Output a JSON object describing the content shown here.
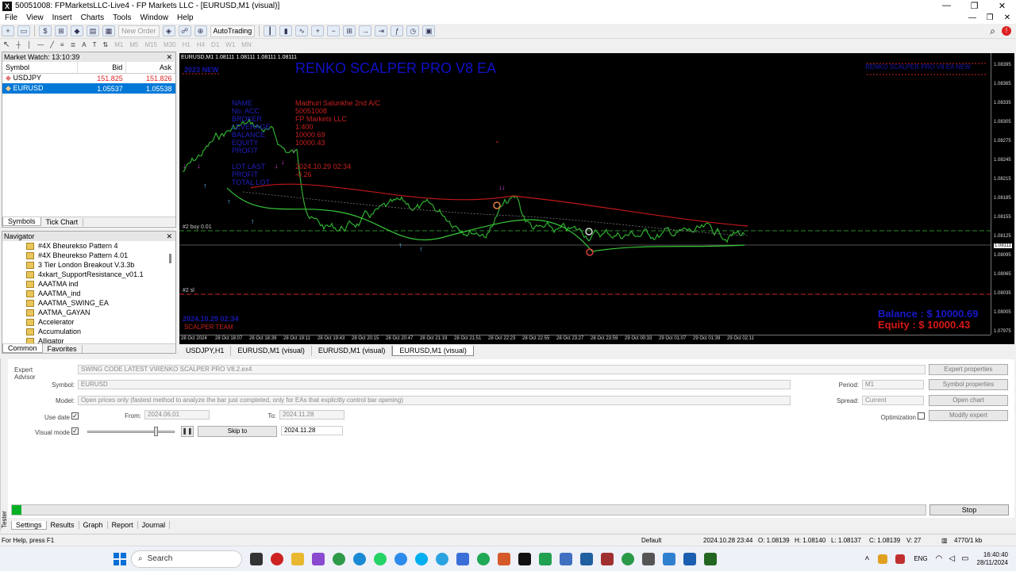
{
  "window": {
    "title": "50051008: FPMarketsLLC-Live4 - FP Markets LLC - [EURUSD,M1 (visual)]"
  },
  "menu": [
    "File",
    "View",
    "Insert",
    "Charts",
    "Tools",
    "Window",
    "Help"
  ],
  "toolbar": {
    "new_order": "New Order",
    "autotrading": "AutoTrading"
  },
  "timeframes": [
    "M1",
    "M5",
    "M15",
    "M30",
    "H1",
    "H4",
    "D1",
    "W1",
    "MN"
  ],
  "market_watch": {
    "title": "Market Watch: 13:10:39",
    "columns": [
      "Symbol",
      "Bid",
      "Ask"
    ],
    "rows": [
      {
        "symbol": "USDJPY",
        "bid": "151.825",
        "ask": "151.826"
      },
      {
        "symbol": "EURUSD",
        "bid": "1.05537",
        "ask": "1.05538"
      }
    ],
    "tabs": [
      "Symbols",
      "Tick Chart"
    ]
  },
  "navigator": {
    "title": "Navigator",
    "items": [
      "#4X Bheurekso Pattern 4",
      "#4X Bheurekso Pattern 4.01",
      "3 Tier London Breakout V.3.3b",
      "4xkart_SupportResistance_v01.1",
      "AAATMA ind",
      "AAATMA_ind",
      "AAATMA_SWING_EA",
      "AATMA_GAYAN",
      "Accelerator",
      "Accumulation",
      "Alligator"
    ],
    "tabs": [
      "Common",
      "Favorites"
    ]
  },
  "chart": {
    "header": "EURUSD,M1  1.08111 1.08111 1.08111 1.08111",
    "ea_title": "RENKO SCALPER PRO V8 EA",
    "year_label": "2023 NEW",
    "info_labels": [
      "NAME",
      "No. ACC",
      "BROKER",
      "LEVERAGE",
      "BALANCE",
      "EQUITY",
      "PROFIT",
      "",
      "LOT LAST",
      "PROFIT",
      "TOTAL LOT"
    ],
    "info_values": [
      "Madhuri Salunkhe 2nd A/C",
      "50051008",
      "FP Markets LLC",
      "1:400",
      "10000.69",
      "10000.43",
      "",
      "",
      "2024.10.29 02:34",
      "-0.26",
      ""
    ],
    "right_top": "RENKO SCALPER PRO V8 EA NEW",
    "balance": "Balance  : $ 10000.69",
    "equity": "Equity    : $ 10000.43",
    "date_label": "2024.10.29 02:34",
    "team_label": "SCALPER TEAM",
    "buy_line": "#2 buy 0.01",
    "sl_line": "#2 sl",
    "current_price": "1.08111",
    "prices": [
      "1.08395",
      "1.08365",
      "1.08335",
      "1.08305",
      "1.08275",
      "1.08245",
      "1.08215",
      "1.08185",
      "1.08155",
      "1.08125",
      "1.08111",
      "1.08095",
      "1.08065",
      "1.08035",
      "1.08005",
      "1.07975"
    ],
    "times": [
      "28 Oct 2024",
      "28 Oct 18:07",
      "28 Oct 18:39",
      "28 Oct 19:11",
      "28 Oct 19:43",
      "28 Oct 20:15",
      "28 Oct 20:47",
      "28 Oct 21:19",
      "28 Oct 21:51",
      "28 Oct 22:23",
      "28 Oct 22:55",
      "28 Oct 23:27",
      "28 Oct 23:59",
      "29 Oct 00:33",
      "29 Oct 01:07",
      "29 Oct 01:39",
      "29 Oct 02:11"
    ]
  },
  "chart_tabs": [
    "USDJPY,H1",
    "EURUSD,M1 (visual)",
    "EURUSD,M1 (visual)",
    "EURUSD,M1 (visual)"
  ],
  "tester": {
    "expert_advisor_label": "Expert Advisor",
    "expert_advisor": "SWING CODE LATEST V\\RENKO SCALPER PRO V8.2.ex4",
    "symbol_label": "Symbol:",
    "symbol": "EURUSD",
    "model_label": "Model:",
    "model": "Open prices only (fastest method to analyze the bar just completed, only for EAs that explicitly control bar opening)",
    "use_date": "Use date",
    "from_label": "From:",
    "from": "2024.06.01",
    "to_label": "To:",
    "to": "2024.11.28",
    "visual_mode": "Visual mode",
    "skip_to": "Skip to",
    "skip_date": "2024.11.28",
    "period_label": "Period:",
    "period": "M1",
    "spread_label": "Spread:",
    "spread": "Current",
    "optimization": "Optimization",
    "btn_expert": "Expert properties",
    "btn_symbol": "Symbol properties",
    "btn_chart": "Open chart",
    "btn_modify": "Modify expert",
    "stop": "Stop",
    "progress": 0.01,
    "tabs": [
      "Settings",
      "Results",
      "Graph",
      "Report",
      "Journal"
    ],
    "vertical": "Tester"
  },
  "status": {
    "help": "For Help, press F1",
    "profile": "Default",
    "time": "2024.10.28 23:44",
    "open": "O: 1.08139",
    "high": "H: 1.08140",
    "low": "L: 1.08137",
    "close": "C: 1.08139",
    "volume": "V: 27",
    "traffic": "4770/1 kb"
  },
  "taskbar": {
    "search": "Search",
    "lang": "ENG",
    "time": "16:40:40",
    "date": "28/11/2024"
  }
}
